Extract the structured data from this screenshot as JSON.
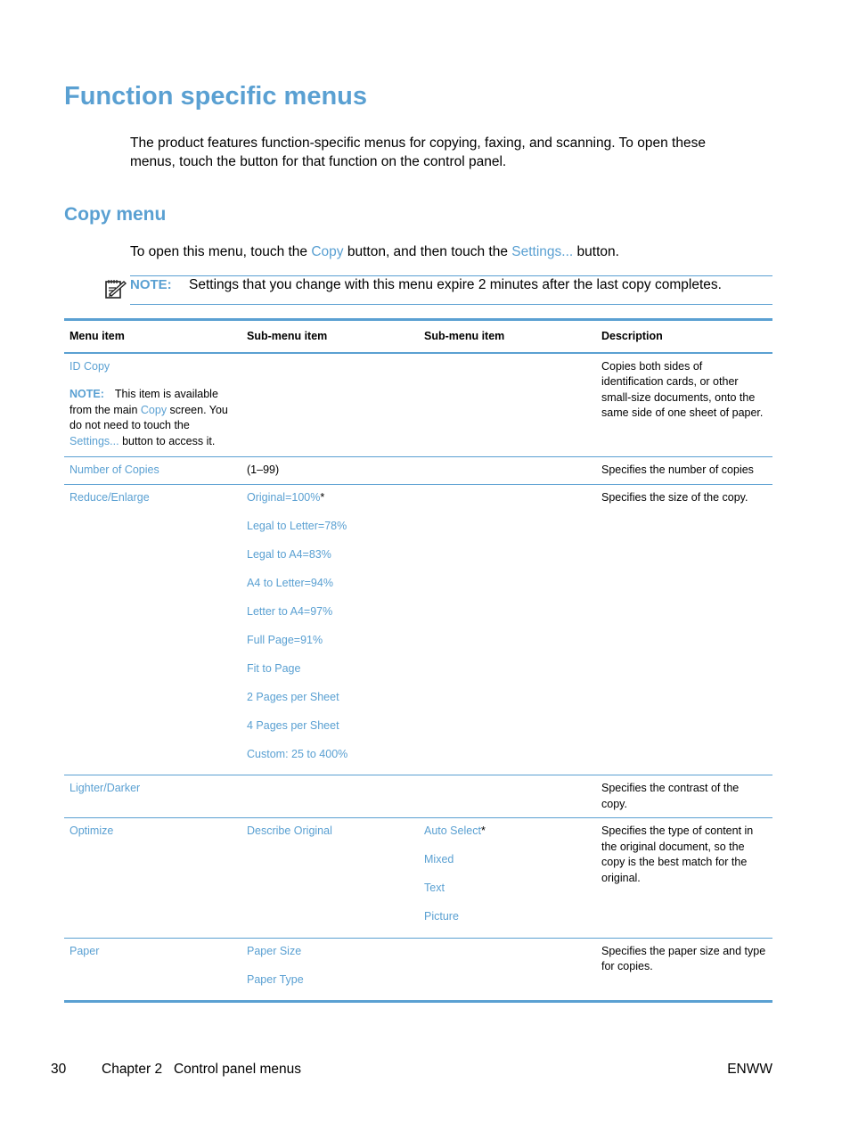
{
  "page": {
    "title": "Function specific menus",
    "intro": "The product features function-specific menus for copying, faxing, and scanning. To open these menus, touch the button for that function on the control panel.",
    "section_title": "Copy menu",
    "open_instructions": {
      "prefix": "To open this menu, touch the ",
      "link1": "Copy",
      "middle": " button, and then touch the ",
      "link2": "Settings...",
      "suffix": " button."
    },
    "note": {
      "icon": "note-pencil-icon",
      "label": "NOTE:",
      "text": "Settings that you change with this menu expire 2 minutes after the last copy completes."
    }
  },
  "table": {
    "headers": [
      "Menu item",
      "Sub-menu item",
      "Sub-menu item",
      "Description"
    ],
    "rows": [
      {
        "menu_item": "ID Copy",
        "menu_note": {
          "label": "NOTE:",
          "t1": "This item is available from the main ",
          "link1": "Copy",
          "t2": " screen. You do not need to touch the ",
          "link2": "Settings...",
          "t3": " button to access it."
        },
        "sub1": [],
        "sub2": [],
        "description": "Copies both sides of identification cards, or other small-size documents, onto the same side of one sheet of paper."
      },
      {
        "menu_item": "Number of Copies",
        "sub1_plain": "(1–99)",
        "description": "Specifies the number of copies"
      },
      {
        "menu_item": "Reduce/Enlarge",
        "sub1": [
          "Original=100%",
          "Legal to Letter=78%",
          "Legal to A4=83%",
          "A4 to Letter=94%",
          "Letter to A4=97%",
          "Full Page=91%",
          "Fit to Page",
          "2 Pages per Sheet",
          "4 Pages per Sheet",
          "Custom: 25 to 400%"
        ],
        "default_marker": "*",
        "description": "Specifies the size of the copy."
      },
      {
        "menu_item": "Lighter/Darker",
        "description": "Specifies the contrast of the copy."
      },
      {
        "menu_item": "Optimize",
        "sub1": [
          "Describe Original"
        ],
        "sub2": [
          "Auto Select",
          "Mixed",
          "Text",
          "Picture"
        ],
        "default_marker": "*",
        "description": "Specifies the type of content in the original document, so the copy is the best match for the original."
      },
      {
        "menu_item": "Paper",
        "sub1": [
          "Paper Size",
          "Paper Type"
        ],
        "description": "Specifies the paper size and type for copies."
      }
    ]
  },
  "footer": {
    "page_number": "30",
    "chapter": "Chapter 2   Control panel menus",
    "right": "ENWW"
  },
  "colors": {
    "accent": "#5aa0d2",
    "text": "#000000"
  }
}
